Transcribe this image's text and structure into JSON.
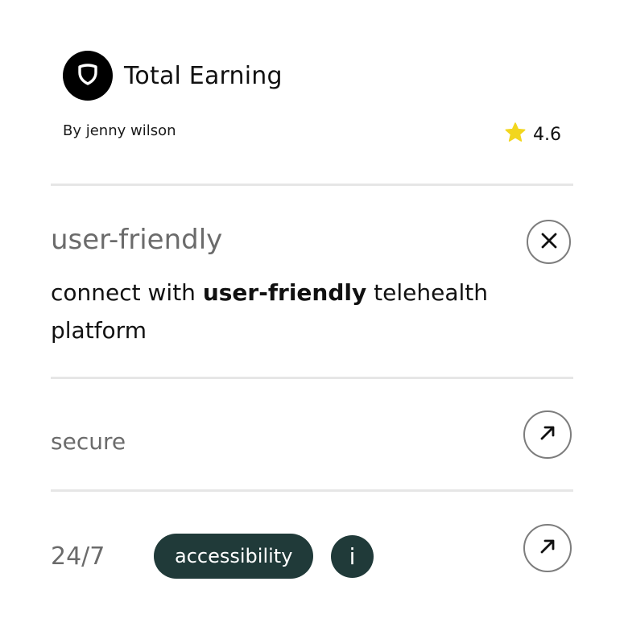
{
  "header": {
    "title": "Total Earning",
    "logo_icon": "shield-icon",
    "author": "By jenny wilson",
    "rating": "4.6",
    "rating_icon": "star-icon",
    "star_color": "#f2d61e"
  },
  "items": [
    {
      "title": "user-friendly",
      "description": {
        "before": "connect with ",
        "highlight": "user-friendly",
        "after": " telehealth platform"
      },
      "action_icon": "close-icon"
    },
    {
      "title": "secure",
      "action_icon": "arrow-up-right-icon"
    },
    {
      "title": "24/7",
      "tag": "accessibility",
      "info_label": "i",
      "action_icon": "arrow-up-right-icon"
    }
  ],
  "colors": {
    "accent_dark": "#203a39",
    "muted_text": "#6b6b6b",
    "divider": "#e6e6e6"
  }
}
